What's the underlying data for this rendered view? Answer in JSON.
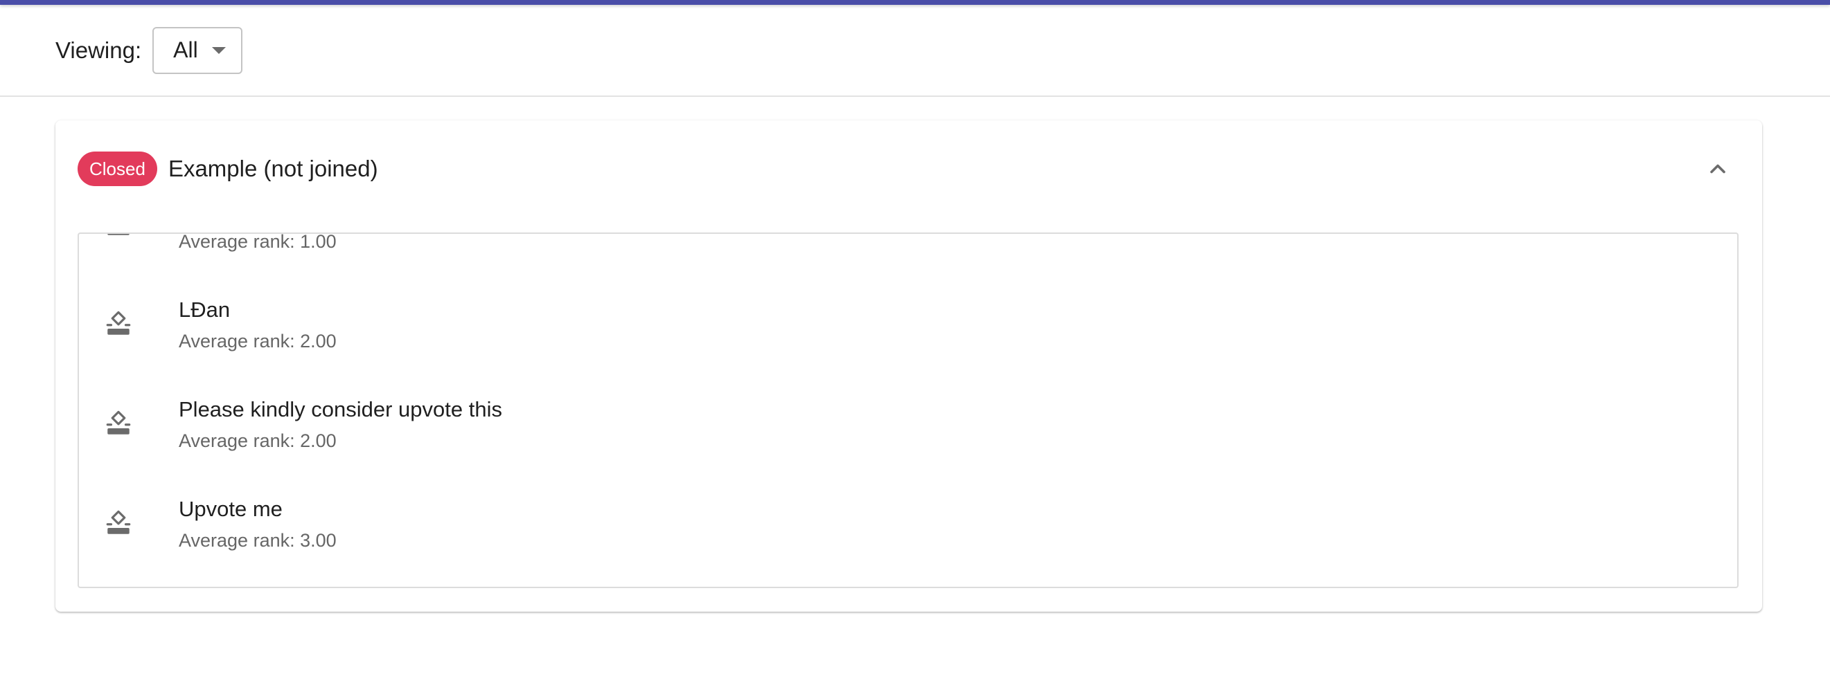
{
  "filter": {
    "label": "Viewing:",
    "selected": "All"
  },
  "card": {
    "status_badge": "Closed",
    "title": "Example (not joined)",
    "items": [
      {
        "title": "",
        "subtitle": "Average rank: 1.00"
      },
      {
        "title": "LĐan",
        "subtitle": "Average rank: 2.00"
      },
      {
        "title": "Please kindly consider upvote this",
        "subtitle": "Average rank: 2.00"
      },
      {
        "title": "Upvote me",
        "subtitle": "Average rank: 3.00"
      }
    ]
  },
  "colors": {
    "top_bar": "#4a4ea8",
    "badge": "#e23b5b",
    "icon": "#6b6b6b"
  },
  "icons": {
    "item_icon": "ballot-box-icon",
    "collapse": "chevron-up-icon",
    "select_arrow": "caret-down-icon"
  }
}
